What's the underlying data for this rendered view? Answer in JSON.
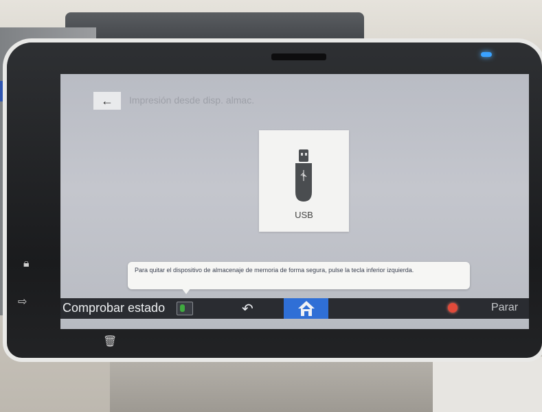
{
  "screen": {
    "title": "Impresión desde disp. almac.",
    "subtitle": "",
    "top_right": "",
    "back_icon": "←"
  },
  "storage": {
    "usb_label": "USB"
  },
  "tooltip": {
    "text": "Para quitar el dispositivo de almacenaje de memoria de forma segura, pulse la tecla inferior izquierda."
  },
  "bottom_bar": {
    "check_status_label": "Comprobar estado",
    "back_symbol": "↶",
    "stop_label": "Parar"
  },
  "colors": {
    "home_button": "#2f6fd6",
    "stop": "#e24a3a",
    "status_green": "#3faa3f",
    "power_led": "#3aa2ff"
  }
}
